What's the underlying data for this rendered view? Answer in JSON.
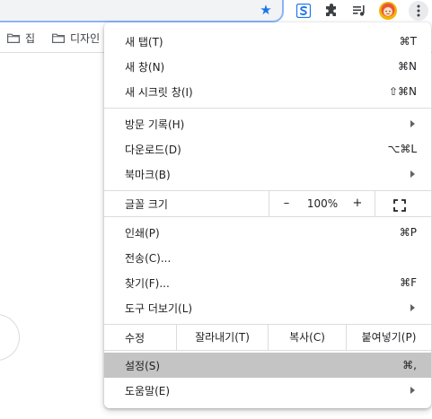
{
  "toolbar": {
    "icons": [
      "bookmark-star-icon",
      "extension-s-icon",
      "extensions-puzzle-icon",
      "media-queue-icon",
      "profile-avatar-icon",
      "chrome-menu-kebab-icon"
    ],
    "accent": "#1a73e8"
  },
  "bookmarks": [
    {
      "label": "집",
      "icon": "folder-icon"
    },
    {
      "label": "디자인",
      "icon": "folder-icon"
    }
  ],
  "menu": {
    "new_tab": {
      "label": "새 탭(T)",
      "shortcut": "⌘T"
    },
    "new_window": {
      "label": "새 창(N)",
      "shortcut": "⌘N"
    },
    "new_incognito": {
      "label": "새 시크릿 창(I)",
      "shortcut": "⇧⌘N"
    },
    "history": {
      "label": "방문 기록(H)"
    },
    "downloads": {
      "label": "다운로드(D)",
      "shortcut": "⌥⌘L"
    },
    "bookmarks": {
      "label": "북마크(B)"
    },
    "zoom": {
      "label": "글꼴 크기",
      "minus": "–",
      "value": "100%",
      "plus": "+"
    },
    "print": {
      "label": "인쇄(P)",
      "shortcut": "⌘P"
    },
    "cast": {
      "label": "전송(C)..."
    },
    "find": {
      "label": "찾기(F)...",
      "shortcut": "⌘F"
    },
    "more_tools": {
      "label": "도구 더보기(L)"
    },
    "edit": {
      "label": "수정",
      "cut": "잘라내기(T)",
      "copy": "복사(C)",
      "paste": "붙여넣기(P)"
    },
    "settings": {
      "label": "설정(S)",
      "shortcut": "⌘,"
    },
    "help": {
      "label": "도움말(E)"
    },
    "highlight_color": "#c4c4c4"
  }
}
